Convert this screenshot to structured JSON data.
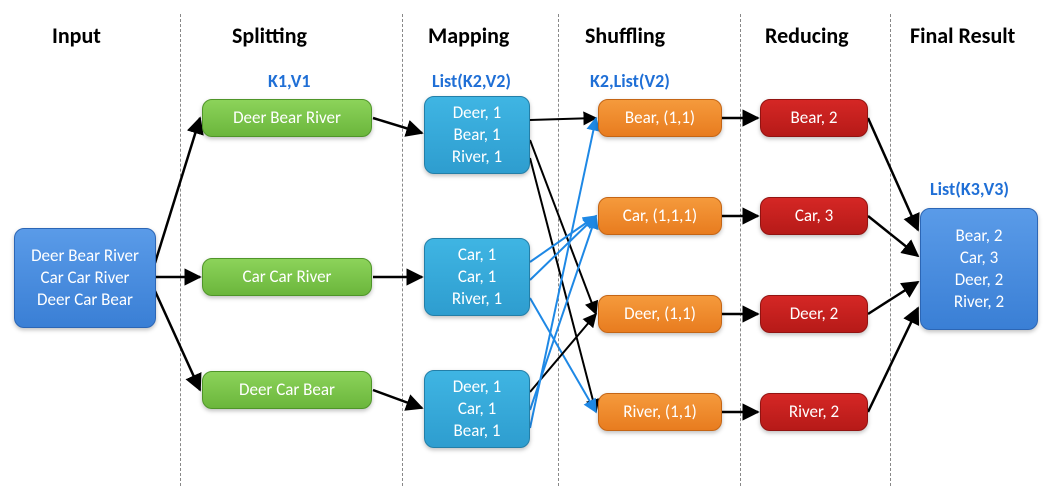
{
  "chart_data": {
    "type": "flow-diagram",
    "stages": [
      "Input",
      "Splitting",
      "Mapping",
      "Shuffling",
      "Reducing",
      "Final Result"
    ],
    "stage_type_labels": {
      "Splitting": "K1,V1",
      "Mapping": "List(K2,V2)",
      "Shuffling": "K2,List(V2)",
      "Final Result": "List(K3,V3)"
    },
    "input": [
      "Deer Bear River",
      "Car Car River",
      "Deer Car Bear"
    ],
    "splitting": [
      "Deer Bear River",
      "Car Car River",
      "Deer Car Bear"
    ],
    "mapping": [
      [
        [
          "Deer",
          1
        ],
        [
          "Bear",
          1
        ],
        [
          "River",
          1
        ]
      ],
      [
        [
          "Car",
          1
        ],
        [
          "Car",
          1
        ],
        [
          "River",
          1
        ]
      ],
      [
        [
          "Deer",
          1
        ],
        [
          "Car",
          1
        ],
        [
          "Bear",
          1
        ]
      ]
    ],
    "shuffling": [
      [
        "Bear",
        [
          1,
          1
        ]
      ],
      [
        "Car",
        [
          1,
          1,
          1
        ]
      ],
      [
        "Deer",
        [
          1,
          1
        ]
      ],
      [
        "River",
        [
          1,
          1
        ]
      ]
    ],
    "reducing": [
      [
        "Bear",
        2
      ],
      [
        "Car",
        3
      ],
      [
        "Deer",
        2
      ],
      [
        "River",
        2
      ]
    ],
    "final_result": [
      [
        "Bear",
        2
      ],
      [
        "Car",
        3
      ],
      [
        "Deer",
        2
      ],
      [
        "River",
        2
      ]
    ]
  },
  "headers": {
    "c1": "Input",
    "c2": "Splitting",
    "c3": "Mapping",
    "c4": "Shuffling",
    "c5": "Reducing",
    "c6": "Final Result"
  },
  "subheaders": {
    "c2": "K1,V1",
    "c3": "List(K2,V2)",
    "c4": "K2,List(V2)",
    "c6": "List(K3,V3)"
  },
  "nodes": {
    "input": {
      "l1": "Deer Bear River",
      "l2": "Car Car River",
      "l3": "Deer Car Bear"
    },
    "split1": "Deer Bear River",
    "split2": "Car Car River",
    "split3": "Deer Car Bear",
    "map1": {
      "l1": "Deer, 1",
      "l2": "Bear, 1",
      "l3": "River, 1"
    },
    "map2": {
      "l1": "Car, 1",
      "l2": "Car, 1",
      "l3": "River, 1"
    },
    "map3": {
      "l1": "Deer, 1",
      "l2": "Car, 1",
      "l3": "Bear, 1"
    },
    "shuf1": "Bear, (1,1)",
    "shuf2": "Car, (1,1,1)",
    "shuf3": "Deer, (1,1)",
    "shuf4": "River, (1,1)",
    "red1": "Bear, 2",
    "red2": "Car, 3",
    "red3": "Deer, 2",
    "red4": "River, 2",
    "final": {
      "l1": "Bear, 2",
      "l2": "Car, 3",
      "l3": "Deer, 2",
      "l4": "River, 2"
    }
  },
  "colors": {
    "blue": "#3a7fd5",
    "green": "#6bb63c",
    "cyan": "#2e9dcf",
    "orange": "#e87c1f",
    "red": "#b61a18",
    "header_blue": "#1f6fd6"
  }
}
